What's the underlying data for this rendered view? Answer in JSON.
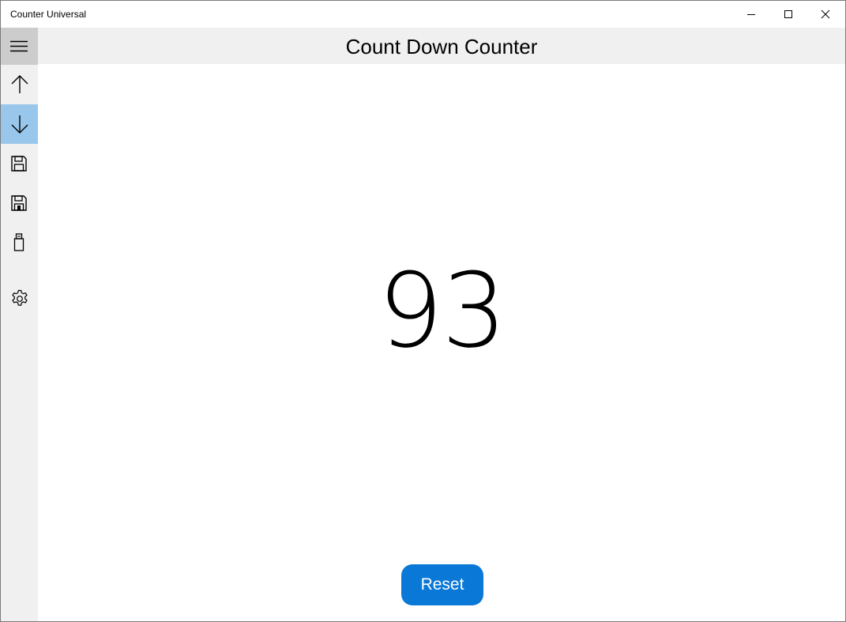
{
  "window": {
    "title": "Counter Universal",
    "controls": {
      "minimize_icon": "minimize-icon",
      "maximize_icon": "maximize-icon",
      "close_icon": "close-icon"
    }
  },
  "nav": {
    "items": [
      {
        "icon": "hamburger-icon",
        "selected": false
      },
      {
        "icon": "arrow-up-icon",
        "selected": false
      },
      {
        "icon": "arrow-down-icon",
        "selected": true
      },
      {
        "icon": "save-icon",
        "selected": false
      },
      {
        "icon": "save-as-icon",
        "selected": false
      },
      {
        "icon": "usb-drive-icon",
        "selected": false
      },
      {
        "icon": "gear-icon",
        "selected": false
      }
    ],
    "selected_color": "#99c7ec",
    "hamburger_bg": "#cccccc"
  },
  "header": {
    "title": "Count Down Counter"
  },
  "counter": {
    "value": "93"
  },
  "actions": {
    "reset_label": "Reset",
    "reset_color": "#0a78d7"
  }
}
